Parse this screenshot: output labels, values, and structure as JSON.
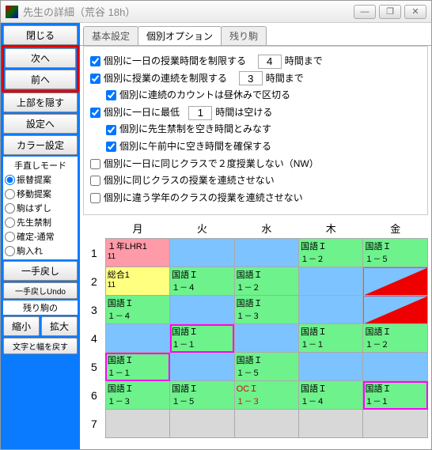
{
  "window": {
    "title": "先生の詳細（荒谷 18h）"
  },
  "titlebar_btns": {
    "min": "—",
    "max": "❐",
    "close": "✕"
  },
  "sidebar": {
    "close": "閉じる",
    "next": "次へ",
    "prev": "前へ",
    "hide_top": "上部を隠す",
    "to_settings": "設定へ",
    "color_settings": "カラー設定",
    "mode_title": "手直しモード",
    "modes": [
      "振替提案",
      "移動提案",
      "駒はずし",
      "先生禁制",
      "確定-通常",
      "駒入れ"
    ],
    "undo_one": "一手戻し",
    "undo_one_small": "一手戻しUndo",
    "remaining": "残り駒の",
    "shrink": "縮小",
    "expand": "拡大",
    "restore": "文字と幅を戻す"
  },
  "tabs": [
    "基本設定",
    "個別オプション",
    "残り駒"
  ],
  "options": {
    "limit_hours": "個別に一日の授業時間を制限する",
    "limit_hours_val": "4",
    "limit_hours_suffix": "時間まで",
    "limit_consec": "個別に授業の連続を制限する",
    "limit_consec_val": "3",
    "limit_consec_suffix": "時間まで",
    "lunch_divider": "個別に連続のカウントは昼休みで区切る",
    "min_empty": "個別に一日に最低",
    "min_empty_val": "1",
    "min_empty_suffix": "時間は空ける",
    "empty_as_ban": "個別に先生禁制を空き時間とみなす",
    "ensure_am_empty": "個別に午前中に空き時間を確保する",
    "no_twice_same_class": "個別に一日に同じクラスで２度授業しない（NW）",
    "no_consec_same_class": "個別に同じクラスの授業を連続させない",
    "no_consec_diff_grade": "個別に違う学年のクラスの授業を連続させない"
  },
  "schedule": {
    "days": [
      "月",
      "火",
      "水",
      "木",
      "金"
    ],
    "rows": [
      {
        "p": "1",
        "cells": [
          {
            "t1": "１年LHR1",
            "t2": "11",
            "cls": "c-pink"
          },
          {
            "cls": "c-blue"
          },
          {
            "cls": "c-blue"
          },
          {
            "t1": "国語Ｉ",
            "t2": "１－２",
            "cls": "c-green"
          },
          {
            "t1": "国語Ｉ",
            "t2": "１－５",
            "cls": "c-green"
          }
        ]
      },
      {
        "p": "2",
        "cells": [
          {
            "t1": "総合1",
            "t2": "11",
            "cls": "c-yellow"
          },
          {
            "t1": "国語Ｉ",
            "t2": "１－４",
            "cls": "c-green"
          },
          {
            "t1": "国語Ｉ",
            "t2": "１－２",
            "cls": "c-green"
          },
          {
            "cls": "c-blue"
          },
          {
            "cls": "diag-red"
          }
        ]
      },
      {
        "p": "3",
        "cells": [
          {
            "t1": "国語Ｉ",
            "t2": "１－４",
            "cls": "c-green"
          },
          {
            "cls": "c-blue"
          },
          {
            "t1": "国語Ｉ",
            "t2": "１－３",
            "cls": "c-green"
          },
          {
            "cls": "c-blue"
          },
          {
            "cls": "diag-red"
          }
        ]
      },
      {
        "p": "4",
        "cells": [
          {
            "cls": "c-blue"
          },
          {
            "t1": "国語Ｉ",
            "t2": "１－１",
            "cls": "c-green",
            "sel": true
          },
          {
            "cls": "c-blue"
          },
          {
            "t1": "国語Ｉ",
            "t2": "１－１",
            "cls": "c-green"
          },
          {
            "t1": "国語Ｉ",
            "t2": "１－２",
            "cls": "c-green"
          }
        ]
      },
      {
        "p": "5",
        "cells": [
          {
            "t1": "国語Ｉ",
            "t2": "１－１",
            "cls": "c-green",
            "sel": true
          },
          {
            "cls": "c-blue"
          },
          {
            "t1": "国語Ｉ",
            "t2": "１－５",
            "cls": "c-green"
          },
          {
            "cls": "c-blue"
          },
          {
            "cls": "c-blue"
          }
        ]
      },
      {
        "p": "6",
        "cells": [
          {
            "t1": "国語Ｉ",
            "t2": "１－３",
            "cls": "c-green"
          },
          {
            "t1": "国語Ｉ",
            "t2": "１－５",
            "cls": "c-green"
          },
          {
            "t1": "OCＩ",
            "t2": "１－３",
            "cls": "c-green",
            "red": true
          },
          {
            "t1": "国語Ｉ",
            "t2": "１－４",
            "cls": "c-green"
          },
          {
            "t1": "国語Ｉ",
            "t2": "１－１",
            "cls": "c-green",
            "sel": true
          }
        ]
      },
      {
        "p": "7",
        "cells": [
          {
            "cls": "c-gray"
          },
          {
            "cls": "c-gray"
          },
          {
            "cls": "c-gray"
          },
          {
            "cls": "c-gray"
          },
          {
            "cls": "c-gray"
          }
        ]
      }
    ]
  }
}
